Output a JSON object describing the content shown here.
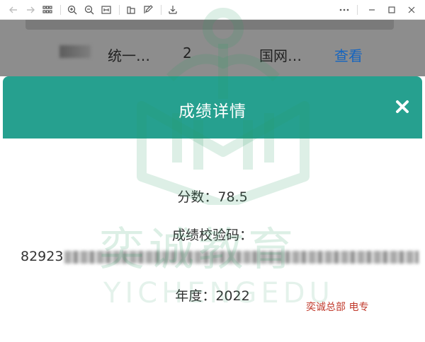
{
  "list_row": {
    "name": "统一…",
    "count": "2",
    "org": "国网…",
    "action": "查看"
  },
  "modal": {
    "title": "成绩详情",
    "score_label": "分数",
    "score_value": "78.5",
    "code_label": "成绩校验码",
    "code_prefix": "82923",
    "year_label": "年度",
    "year_value": "2022",
    "separator": "："
  },
  "watermark": {
    "cn": "奕诚教育",
    "en": "YICHENGEDU",
    "note": "奕诚总部 电专"
  },
  "colors": {
    "header": "#26a08f",
    "link": "#1565c0",
    "overlay": "#8d8d8d",
    "note": "#c0392b"
  },
  "toolbar": {
    "icons": [
      "back-icon",
      "forward-icon",
      "grid-icon",
      "zoom-in-icon",
      "zoom-out-icon",
      "fit-width-icon",
      "rotate-icon",
      "edit-icon",
      "download-icon",
      "more-icon",
      "minimize-icon",
      "maximize-icon",
      "close-icon"
    ]
  }
}
